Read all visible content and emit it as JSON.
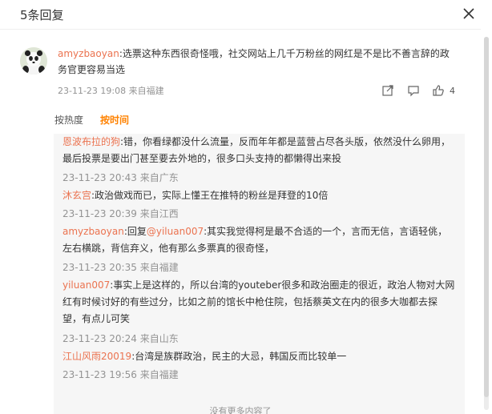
{
  "dialog": {
    "title": "5条回复"
  },
  "comment": {
    "username": "amyzbaoyan",
    "text": ":选票这种东西很奇怪哦，社交网站上几千万粉丝的网红是不是比不善言辞的政务官更容易当选",
    "time": "23-11-23 19:08",
    "source": "来自福建",
    "likes": "4"
  },
  "sort": {
    "hot": "按热度",
    "time": "按时间"
  },
  "replies": [
    {
      "user": "恩波布拉的狗",
      "text": ":错，你看绿都没什么流量，反而年年都是蓝营占尽各头版，依然没什么卵用，最后投票是要出门甚至要去外地的，很多口头支持的都懒得出来投",
      "time": "23-11-23 20:43",
      "source": "来自广东"
    },
    {
      "user": "沐玄宫",
      "text": ":政治做戏而已，实际上懂王在推特的粉丝是拜登的10倍",
      "time": "23-11-23 20:39",
      "source": "来自江西"
    },
    {
      "user": "amyzbaoyan",
      "prefix": ":回复",
      "mention": "@yiluan007",
      "text": ":其实我觉得柯是最不合适的一个，言而无信，言语轻佻，左右横跳，背信弃义，他有那么多票真的很奇怪，",
      "time": "23-11-23 20:35",
      "source": "来自福建"
    },
    {
      "user": "yiluan007",
      "text": ":事实上是这样的，所以台湾的youteber很多和政治圈走的很近，政治人物对大网红有时候讨好的有些过分，比如之前的馆长中枪住院，包括蔡英文在内的很多大咖都去探望，有点儿可笑",
      "time": "23-11-23 20:24",
      "source": "来自山东"
    },
    {
      "user": "江山风雨20019",
      "text": ":台湾是族群政治，民主的大忌，韩国反而比较单一",
      "time": "23-11-23 19:56",
      "source": "来自福建"
    }
  ],
  "footer": {
    "no_more": "没有更多内容了"
  },
  "icons": [
    "close-icon",
    "share-icon",
    "comment-icon",
    "like-icon"
  ]
}
